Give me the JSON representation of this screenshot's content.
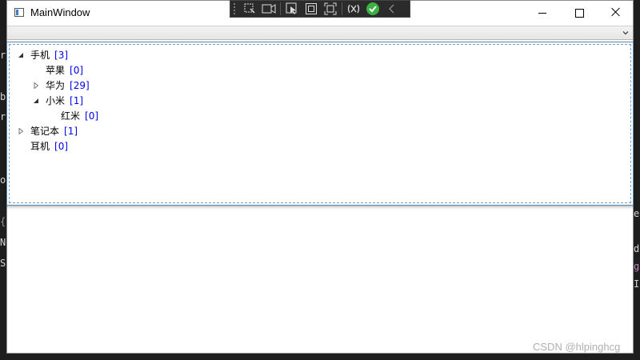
{
  "window": {
    "title": "MainWindow",
    "controls": {
      "minimize": "minimize",
      "maximize": "maximize",
      "close": "close"
    }
  },
  "debug_toolbar": {
    "buttons": [
      "select-element-icon",
      "preview-icon",
      "pointer-icon",
      "adorner-icon",
      "track-focus-icon",
      "hot-reload-icon",
      "check-icon",
      "collapse-icon"
    ]
  },
  "combobox": {
    "value": ""
  },
  "tree": [
    {
      "name": "手机",
      "count": "[3]",
      "level": 0,
      "state": "expanded"
    },
    {
      "name": "苹果",
      "count": "[0]",
      "level": 1,
      "state": "leaf"
    },
    {
      "name": "华为",
      "count": "[29]",
      "level": 1,
      "state": "collapsed"
    },
    {
      "name": "小米",
      "count": "[1]",
      "level": 1,
      "state": "expanded"
    },
    {
      "name": "红米",
      "count": "[0]",
      "level": 2,
      "state": "leaf"
    },
    {
      "name": "笔记本",
      "count": "[1]",
      "level": 0,
      "state": "collapsed"
    },
    {
      "name": "耳机",
      "count": "[0]",
      "level": 0,
      "state": "leaf"
    }
  ],
  "background_code": {
    "left": [
      "r",
      "b",
      "r",
      "o",
      "{",
      "N",
      "S"
    ],
    "right": [
      "e",
      "d",
      "g",
      "I"
    ]
  },
  "watermark": "CSDN @hlpinghcg",
  "colors": {
    "count_text": "#0000ee",
    "popup_border": "#5b8bb0"
  }
}
